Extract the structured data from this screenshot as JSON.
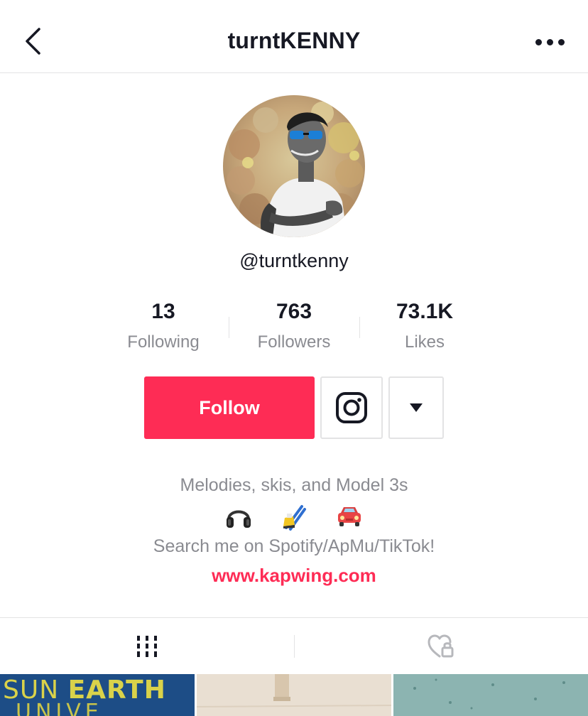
{
  "header": {
    "title": "turntKENNY",
    "back_icon": "chevron-left-icon",
    "more_icon": "more-horizontal-icon"
  },
  "profile": {
    "avatar_icon": "profile-avatar",
    "handle": "@turntkenny"
  },
  "stats": [
    {
      "value": "13",
      "label": "Following"
    },
    {
      "value": "763",
      "label": "Followers"
    },
    {
      "value": "73.1K",
      "label": "Likes"
    }
  ],
  "actions": {
    "follow_label": "Follow",
    "instagram_icon": "instagram-icon",
    "dropdown_icon": "caret-down-icon"
  },
  "bio": {
    "line1": "Melodies, skis, and Model 3s",
    "emojis": [
      "headphones-icon",
      "ski-icon",
      "car-icon"
    ],
    "line2": "Search me on Spotify/ApMu/TikTok!",
    "link": "www.kapwing.com"
  },
  "tabs": [
    {
      "name": "videos",
      "icon": "grid-icon",
      "active": true
    },
    {
      "name": "liked",
      "icon": "liked-private-icon",
      "active": false
    }
  ],
  "videos": [
    {
      "text_a": "SUN",
      "text_b": "EARTH",
      "text_c": "UNIVE"
    },
    {},
    {}
  ],
  "colors": {
    "accent": "#fe2c55",
    "text_primary": "#161823",
    "text_secondary": "#8a8b91",
    "divider": "#e3e3e4"
  }
}
